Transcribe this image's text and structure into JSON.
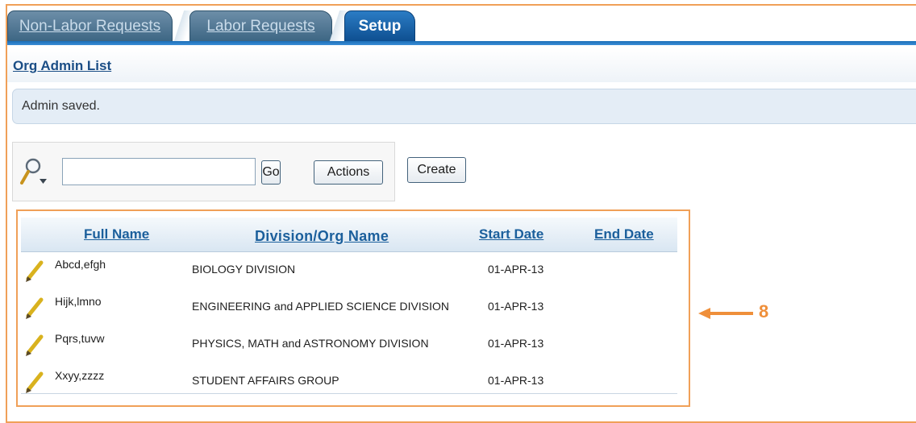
{
  "tabs": [
    {
      "label": "Non-Labor Requests",
      "active": false
    },
    {
      "label": "Labor Requests",
      "active": false
    },
    {
      "label": "Setup",
      "active": true
    }
  ],
  "page_title": "Org Admin List",
  "message": "Admin saved.",
  "search": {
    "value": "",
    "placeholder": "",
    "go_label": "Go",
    "actions_label": "Actions",
    "create_label": "Create",
    "icon": "magnifier-dropdown-icon"
  },
  "table": {
    "columns": [
      "Full Name",
      "Division/Org Name",
      "Start Date",
      "End Date"
    ],
    "rows": [
      {
        "name": "Abcd,efgh",
        "division": "BIOLOGY DIVISION",
        "start": "01-APR-13",
        "end": ""
      },
      {
        "name": "Hijk,lmno",
        "division": "ENGINEERING and APPLIED SCIENCE DIVISION",
        "start": "01-APR-13",
        "end": ""
      },
      {
        "name": "Pqrs,tuvw",
        "division": "PHYSICS, MATH and ASTRONOMY DIVISION",
        "start": "01-APR-13",
        "end": ""
      },
      {
        "name": "Xxyy,zzzz",
        "division": "STUDENT AFFAIRS GROUP",
        "start": "01-APR-13",
        "end": ""
      }
    ],
    "row_icon": "pencil-edit-icon"
  },
  "annotation": {
    "number": "8",
    "color": "#ef8f3a"
  },
  "colors": {
    "tab_active": "#1565b0",
    "link": "#1b5f9c",
    "message_bg": "#e4edf6"
  }
}
